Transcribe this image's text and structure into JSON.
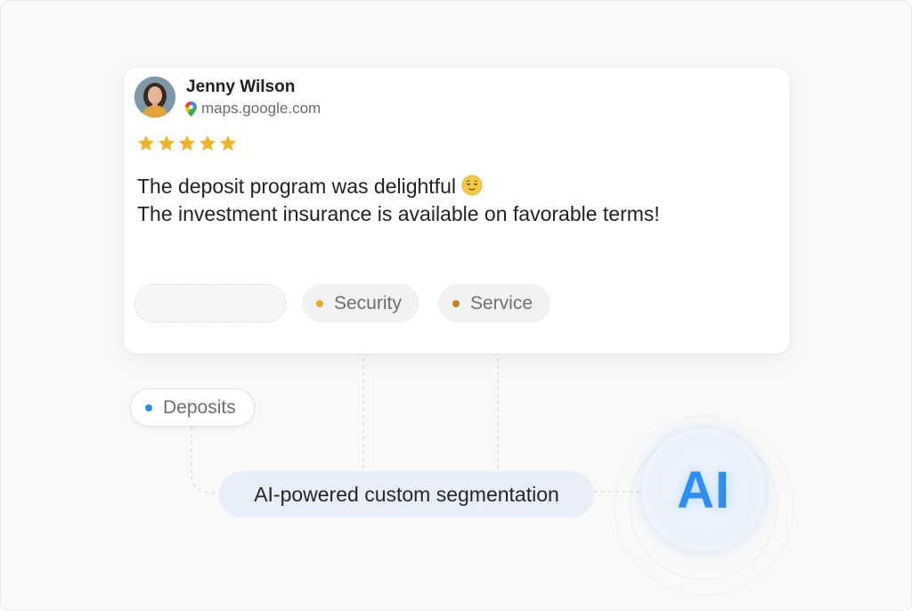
{
  "review": {
    "reviewer_name": "Jenny Wilson",
    "source": "maps.google.com",
    "source_icon": "map-pin-icon",
    "rating": 5,
    "rating_max": 5,
    "star_color": "#f0b429",
    "text_line1": "The deposit program was delightful",
    "text_line1_emoji": "relieved-face-emoji",
    "text_line2": "The investment insurance is available on favorable terms!"
  },
  "tags": {
    "security": {
      "label": "Security",
      "dot_color": "#e8ad1c"
    },
    "service": {
      "label": "Service",
      "dot_color": "#c8831c"
    },
    "deposits": {
      "label": "Deposits",
      "dot_color": "#2e8ef0"
    }
  },
  "segmentation": {
    "label": "AI-powered custom segmentation"
  },
  "ai_badge": {
    "label": "AI",
    "color": "#2e8ef0"
  }
}
